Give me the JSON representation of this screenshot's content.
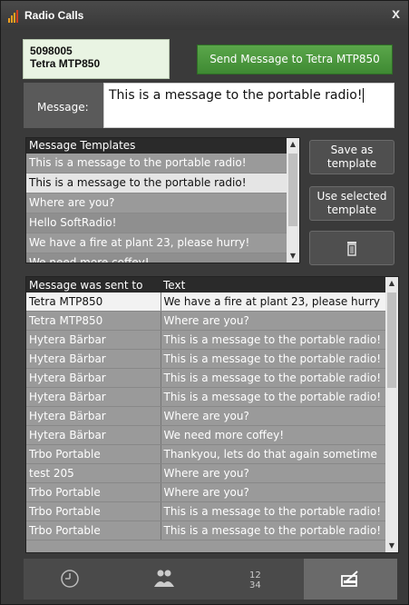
{
  "window": {
    "title": "Radio Calls",
    "close_glyph": "x"
  },
  "recipient": {
    "id": "5098005",
    "name": "Tetra MTP850"
  },
  "send_button": "Send Message to Tetra MTP850",
  "message": {
    "label": "Message:",
    "value": "This is a message to the portable radio!"
  },
  "templates": {
    "header": "Message Templates",
    "items": [
      "This is a message to the portable radio!",
      "This is a message to the portable radio!",
      "Where are you?",
      "Hello SoftRadio!",
      "We have a fire at plant 23, please hurry!",
      "We need more coffey!"
    ],
    "selected_index": 1
  },
  "buttons": {
    "save_template_line1": "Save as",
    "save_template_line2": "template",
    "use_template_line1": "Use selected",
    "use_template_line2": "template"
  },
  "history": {
    "columns": [
      "Message was sent to",
      "Text"
    ],
    "rows": [
      [
        "Tetra MTP850",
        "We have a fire at plant 23, please hurry"
      ],
      [
        "Tetra MTP850",
        "Where are you?"
      ],
      [
        "Hytera Bärbar",
        "This is a message to the portable radio!"
      ],
      [
        "Hytera Bärbar",
        "This is a message to the portable radio!"
      ],
      [
        "Hytera Bärbar",
        "This is a message to the portable radio!"
      ],
      [
        "Hytera Bärbar",
        "This is a message to the portable radio!"
      ],
      [
        "Hytera Bärbar",
        "Where are you?"
      ],
      [
        "Hytera Bärbar",
        "We need more coffey!"
      ],
      [
        "Trbo Portable",
        "Thankyou, lets do that again sometime"
      ],
      [
        "test 205",
        "Where are you?"
      ],
      [
        "Trbo Portable",
        "Where are you?"
      ],
      [
        "Trbo Portable",
        "This is a message to the portable radio!"
      ],
      [
        "Trbo Portable",
        "This is a message to the portable radio!"
      ]
    ],
    "selected_index": 0
  },
  "tabs": [
    {
      "icon": "clock-icon"
    },
    {
      "icon": "contacts-icon"
    },
    {
      "icon": "keypad-icon"
    },
    {
      "icon": "message-icon"
    }
  ],
  "active_tab": 3,
  "colors": {
    "send_green": "#4a9a3c",
    "recipient_bg": "#e9f4e3",
    "logo_orange": "#f0a020"
  }
}
